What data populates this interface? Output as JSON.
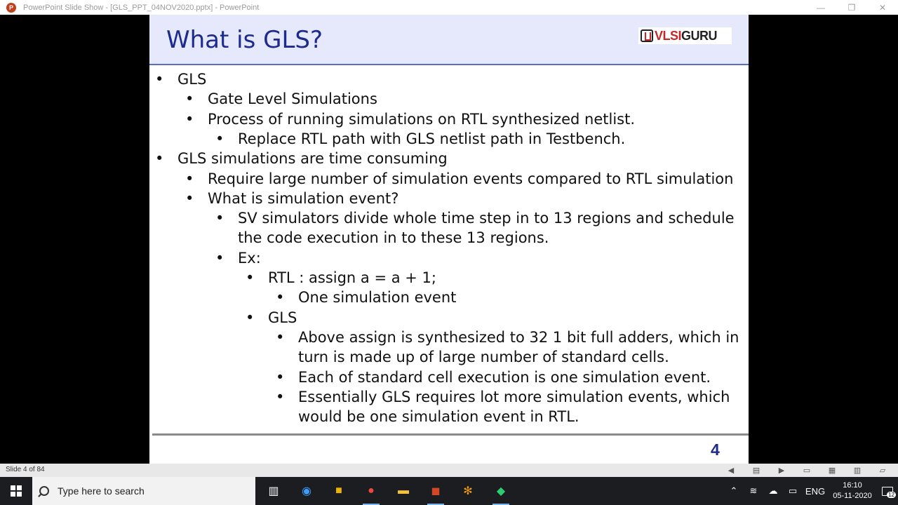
{
  "window": {
    "title": "PowerPoint Slide Show - [GLS_PPT_04NOV2020.pptx] - PowerPoint",
    "minimize": "—",
    "restore": "❐",
    "close": "✕"
  },
  "slide": {
    "title": "What is GLS?",
    "logo_red": "VLSI",
    "logo_dark": "GURU",
    "bullets": [
      {
        "level": 1,
        "text": "GLS"
      },
      {
        "level": 2,
        "text": "Gate Level Simulations"
      },
      {
        "level": 2,
        "text": "Process of running simulations on RTL synthesized netlist."
      },
      {
        "level": 3,
        "text": "Replace RTL path with GLS netlist path in Testbench."
      },
      {
        "level": 1,
        "text": "GLS simulations are time consuming"
      },
      {
        "level": 2,
        "text": "Require large number of simulation events compared to RTL simulation"
      },
      {
        "level": 2,
        "text": "What is simulation event?"
      },
      {
        "level": 3,
        "text": "SV simulators divide whole time step in to 13 regions and schedule"
      },
      {
        "level": 3,
        "text": "the code execution in to these 13 regions.",
        "continuation": true
      },
      {
        "level": 3,
        "text": "Ex:"
      },
      {
        "level": 4,
        "text": "RTL : assign a = a + 1;"
      },
      {
        "level": 5,
        "text": "One simulation event"
      },
      {
        "level": 4,
        "text": "GLS"
      },
      {
        "level": 5,
        "text": "Above assign is synthesized to 32 1 bit full adders, which in"
      },
      {
        "level": 5,
        "text": "turn is made up of large number of standard cells.",
        "continuation": true
      },
      {
        "level": 5,
        "text": "Each of standard cell execution is one simulation event."
      },
      {
        "level": 5,
        "text": "Essentially GLS requires lot more simulation events, which"
      },
      {
        "level": 5,
        "text": "would be one simulation event in RTL.",
        "continuation": true
      }
    ],
    "bullet_glyph": "•",
    "page_number": "4"
  },
  "statusbar": {
    "slide_count": "Slide 4 of 84"
  },
  "taskbar": {
    "search_placeholder": "Type here to search",
    "language": "ENG",
    "time": "16:10",
    "date": "05-11-2020",
    "notification_count": "12"
  }
}
